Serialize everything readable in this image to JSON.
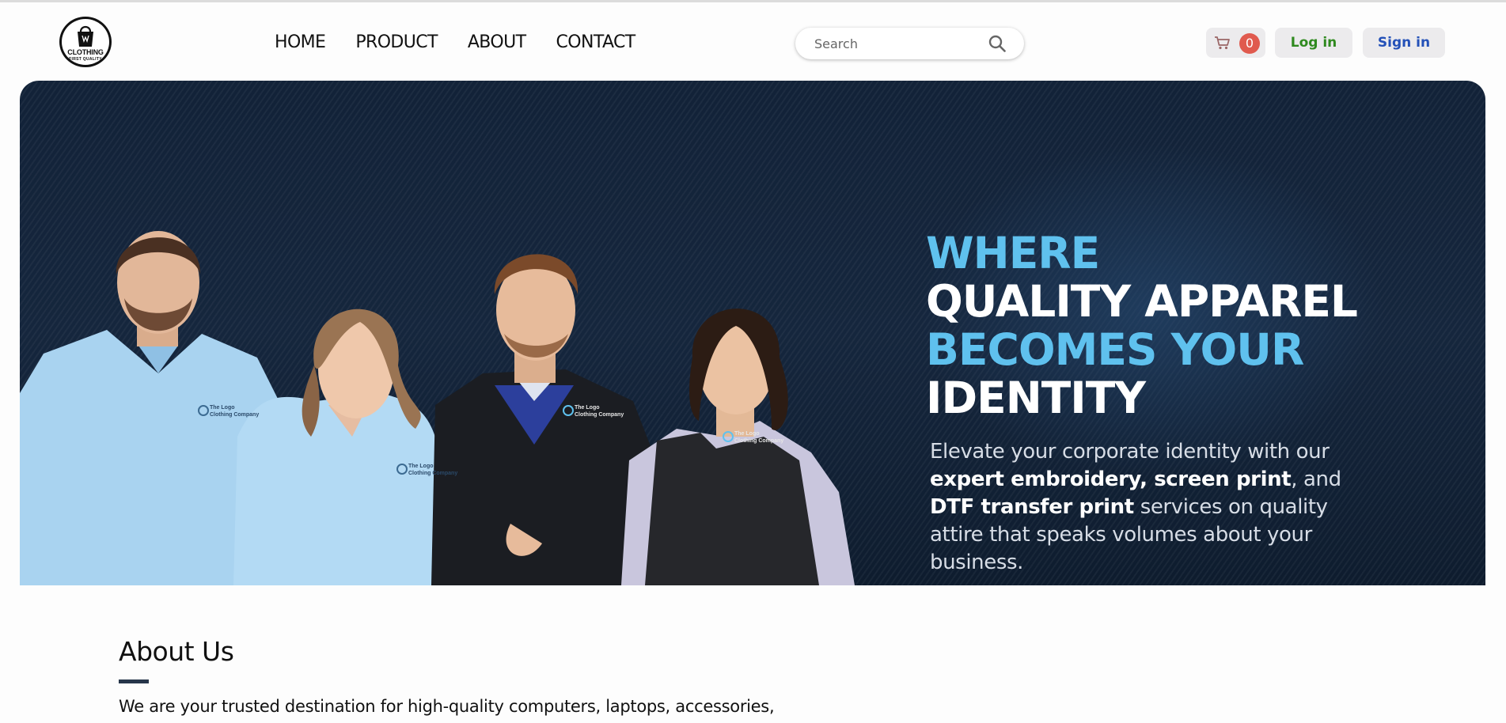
{
  "brand": {
    "name": "CLOTHING",
    "tagline": "FIRST QUALITY"
  },
  "nav": {
    "items": [
      {
        "label": "HOME"
      },
      {
        "label": "PRODUCT"
      },
      {
        "label": "ABOUT"
      },
      {
        "label": "CONTACT"
      }
    ]
  },
  "search": {
    "placeholder": "Search",
    "value": "",
    "icon": "search-icon"
  },
  "cart": {
    "count": "0",
    "icon": "cart-icon",
    "badge_color": "#e05a4e"
  },
  "auth": {
    "login_label": "Log in",
    "signin_label": "Sign in",
    "login_color": "#2f8a1f",
    "signin_color": "#2451b8"
  },
  "hero": {
    "headline": {
      "line1": "WHERE",
      "line2": "QUALITY APPAREL",
      "line3": "BECOMES YOUR",
      "line4": "IDENTITY"
    },
    "text": {
      "p1": "Elevate your corporate identity with our ",
      "b1": "expert embroidery, screen print",
      "p2": ", and ",
      "b2": "DTF transfer print",
      "p3": " services on quality attire that speaks volumes about your business."
    },
    "garment_logo": "The Logo Clothing Company",
    "accent_color": "#5fc1ee",
    "background_color": "#15263d"
  },
  "about": {
    "title": "About Us",
    "body": "We are your trusted destination for high-quality computers, laptops, accessories,"
  }
}
